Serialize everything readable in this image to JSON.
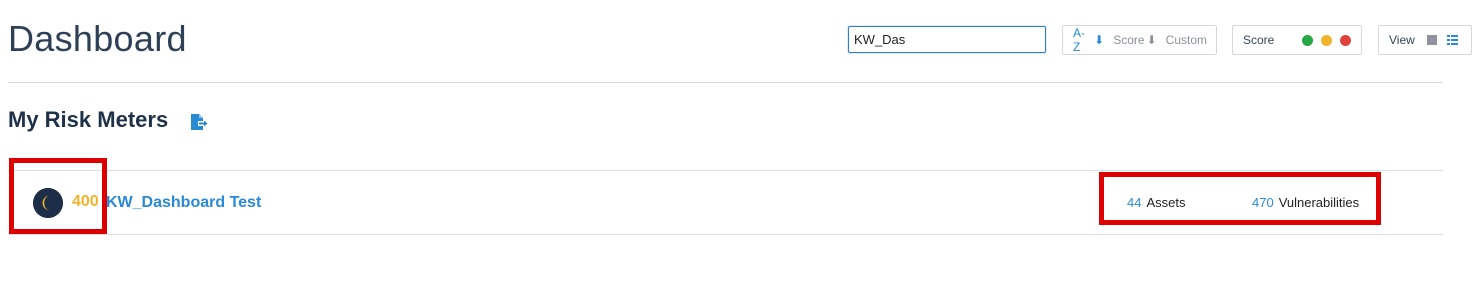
{
  "header": {
    "title": "Dashboard"
  },
  "search": {
    "value": "KW_Das"
  },
  "sort": {
    "options": [
      {
        "label": "A-Z",
        "arrow": "⬇",
        "active": true
      },
      {
        "label": "Score",
        "arrow": "⬇",
        "active": false
      },
      {
        "label": "Custom",
        "arrow": "",
        "active": false
      }
    ]
  },
  "score_filter": {
    "label": "Score",
    "colors": [
      "#27a845",
      "#f0b429",
      "#e0413c"
    ]
  },
  "view": {
    "label": "View",
    "icons": [
      "grid-icon",
      "list-icon"
    ]
  },
  "section": {
    "title": "My Risk Meters",
    "action_icon": "export-icon"
  },
  "meters": [
    {
      "score": "400",
      "name": "KW_Dashboard Test",
      "assets_count": "44",
      "assets_label": "Assets",
      "vulns_count": "470",
      "vulns_label": "Vulnerabilities"
    }
  ],
  "colors": {
    "accent": "#2a8ad4",
    "score_medium": "#f0b429",
    "highlight": "#dd0000"
  }
}
